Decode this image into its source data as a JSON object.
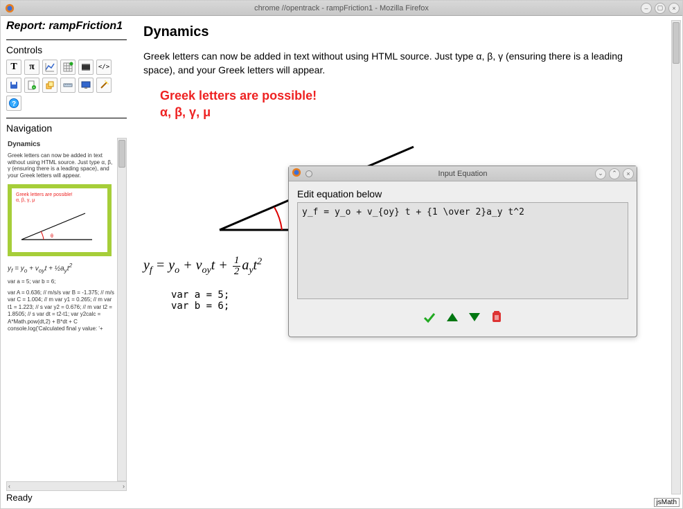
{
  "window": {
    "title": "chrome //opentrack - rampFriction1 - Mozilla Firefox"
  },
  "sidebar": {
    "report_label": "Report: rampFriction1",
    "controls_label": "Controls",
    "navigation_label": "Navigation",
    "tools": [
      {
        "name": "text-tool",
        "glyph": "T"
      },
      {
        "name": "pi-tool",
        "glyph": "π"
      },
      {
        "name": "chart-tool",
        "glyph": ""
      },
      {
        "name": "table-tool",
        "glyph": ""
      },
      {
        "name": "video-tool",
        "glyph": ""
      },
      {
        "name": "code-tool",
        "glyph": "</>"
      },
      {
        "name": "save-tool",
        "glyph": ""
      },
      {
        "name": "new-tool",
        "glyph": ""
      },
      {
        "name": "layers-tool",
        "glyph": ""
      },
      {
        "name": "ruler-tool",
        "glyph": ""
      },
      {
        "name": "monitor-tool",
        "glyph": ""
      },
      {
        "name": "wand-tool",
        "glyph": ""
      },
      {
        "name": "help-tool",
        "glyph": "?"
      }
    ],
    "nav": {
      "title": "Dynamics",
      "text": "Greek letters can now be added in text without using HTML source. Just type α, β, γ (ensuring there is a leading space), and your Greek letters will appear.",
      "thumb_red1": "Greek letters are possible!",
      "thumb_red2": "α, β, γ, μ",
      "eq_html": "y<sub>f</sub> = y<sub>o</sub> + v<sub>oy</sub>t + ½a<sub>y</sub>t<sup>2</sup>",
      "code1": "var a = 5; var b = 6;",
      "code2": "var A = 0.636; // m/s/s var B = -1.375; // m/s var C = 1.004; // m var y1 = 0.265; // m var t1 = 1.223; // s var y2 = 0.676; // m var t2 = 1.8505; // s var dt = t2-t1; var y2calc = A*Math.pow(dt,2) + B*dt + C console.log('Calculated final y value: '+"
    },
    "status": "Ready"
  },
  "main": {
    "heading": "Dynamics",
    "paragraph": "Greek letters can now be added in text without using HTML source.  Just type α, β, γ (ensuring there is a leading space), and your Greek letters will appear.",
    "red_line1": "Greek letters are possible!",
    "red_line2": "α, β, γ, μ",
    "code": "var a = 5;\nvar b = 6;"
  },
  "dialog": {
    "title": "Input Equation",
    "label": "Edit equation below",
    "value": "y_f = y_o + v_{oy} t + {1 \\over 2}a_y t^2"
  },
  "footer": {
    "jsmath": "jsMath"
  }
}
